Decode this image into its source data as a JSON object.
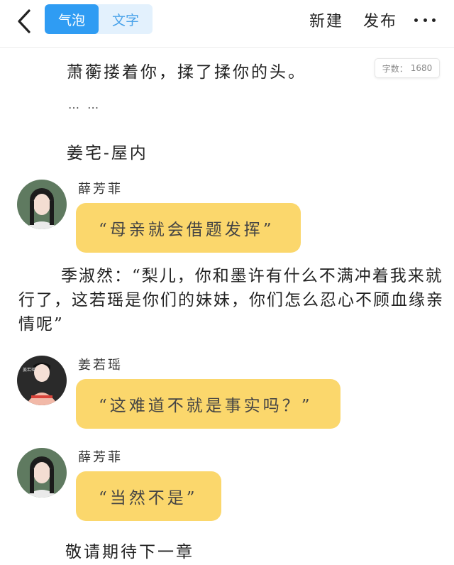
{
  "header": {
    "back_icon": "chevron-left-icon",
    "tabs": [
      {
        "label": "气泡",
        "active": true
      },
      {
        "label": "文字",
        "active": false
      }
    ],
    "new_label": "新建",
    "publish_label": "发布",
    "more_icon": "more-dots-icon"
  },
  "word_count": {
    "label": "字数：",
    "value": "1680"
  },
  "content": {
    "line1": "萧蘅搂着你，揉了揉你的头。",
    "ellipsis": "…  …",
    "scene": "姜宅-屋内",
    "dialog1": {
      "speaker": "薛芳菲",
      "text": "“母亲就会借题发挥”"
    },
    "paragraph": "季淑然：“梨儿，你和墨许有什么不满冲着我来就行了，这若瑶是你们的妹妹，你们怎么忍心不顾血缘亲情呢”",
    "dialog2": {
      "speaker": "姜若瑶",
      "text": "“这难道不就是事实吗？”"
    },
    "dialog3": {
      "speaker": "薛芳菲",
      "text": "“当然不是”"
    },
    "ending": "敬请期待下一章"
  },
  "colors": {
    "accent": "#2f9cf3",
    "tab_inactive_bg": "#e3f1fd",
    "bubble": "#fbd76c"
  }
}
